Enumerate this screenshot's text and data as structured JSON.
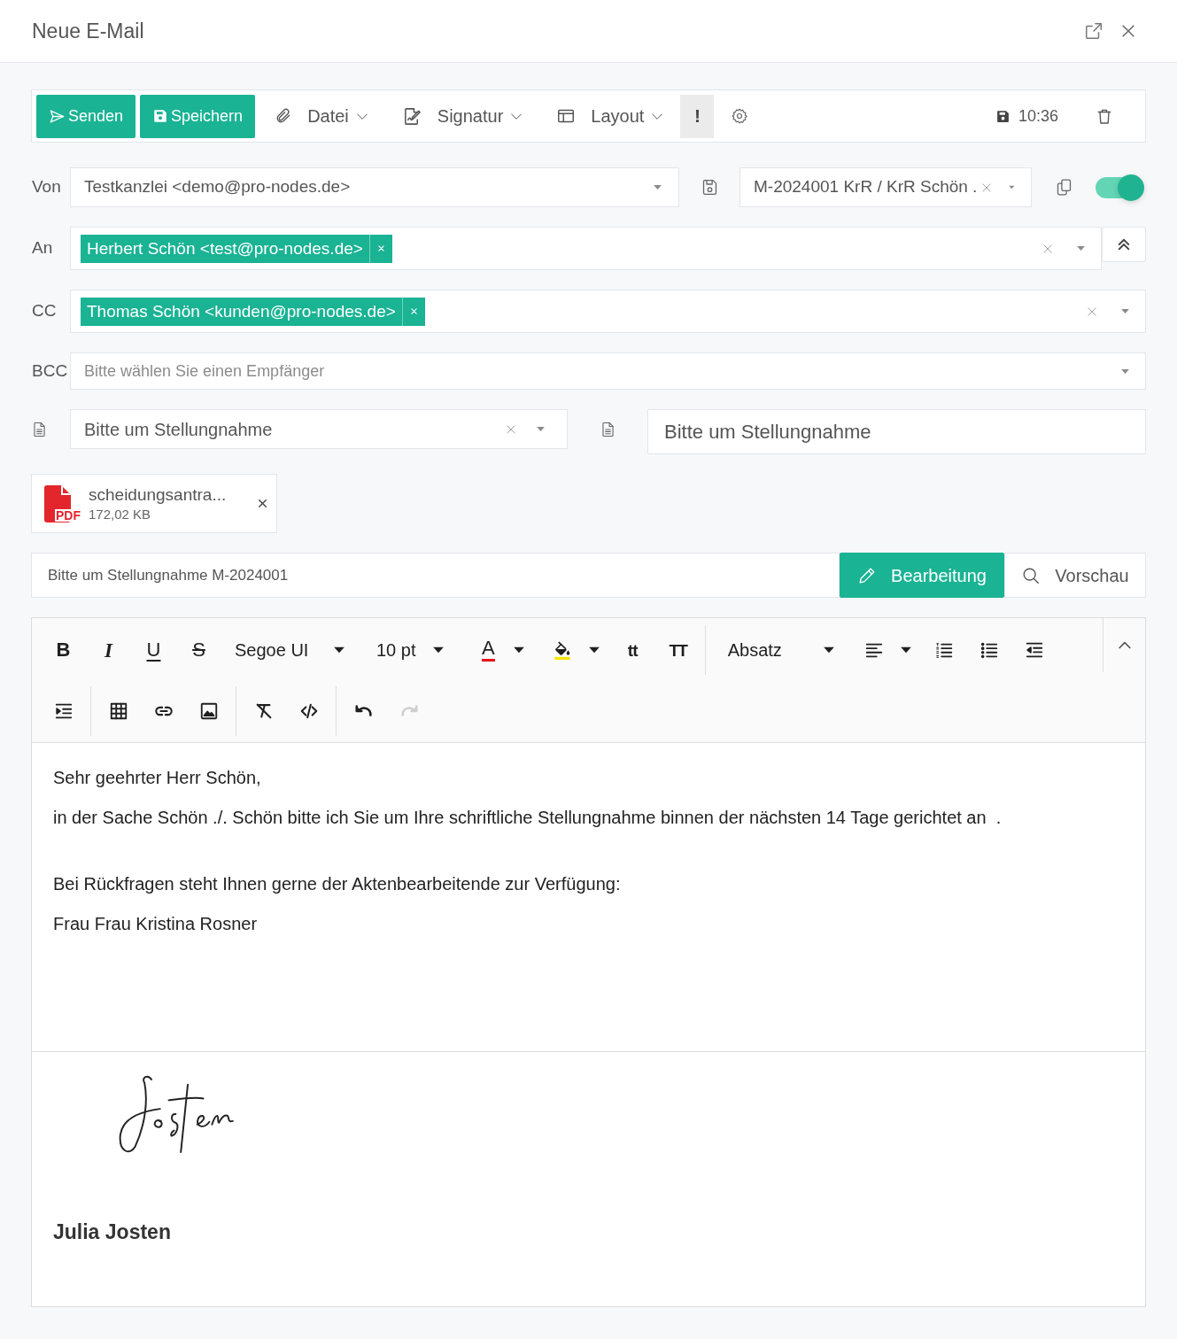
{
  "window": {
    "title": "Neue E-Mail"
  },
  "toolbar": {
    "actions": [
      {
        "kind": "send",
        "label": "Senden"
      },
      {
        "kind": "save",
        "label": "Speichern"
      }
    ],
    "menus": [
      {
        "kind": "attach",
        "label": "Datei"
      },
      {
        "kind": "signature",
        "label": "Signatur"
      },
      {
        "kind": "layout",
        "label": "Layout"
      }
    ],
    "priority": {
      "label": "!",
      "on": true
    },
    "saved_time": "10:36"
  },
  "from": {
    "label": "Von",
    "value": "Testkanzlei <demo@pro-nodes.de>"
  },
  "case_file": {
    "value": "M-2024001 KrR / KrR Schön ."
  },
  "case_link": {
    "on": true
  },
  "to": {
    "label": "An",
    "recipients": [
      "Herbert Schön <test@pro-nodes.de>"
    ]
  },
  "cc": {
    "label": "CC",
    "recipients": [
      "Thomas Schön <kunden@pro-nodes.de>"
    ]
  },
  "bcc": {
    "label": "BCC",
    "placeholder": "Bitte wählen Sie einen Empfänger"
  },
  "template": {
    "value": "Bitte um Stellungnahme"
  },
  "template_title": {
    "value": "Bitte um Stellungnahme"
  },
  "attachments": [
    {
      "type": "PDF",
      "name": "scheidungsantra...",
      "size": "172,02 KB"
    }
  ],
  "subject": {
    "value": "Bitte um Stellungnahme M-2024001"
  },
  "view_tabs": [
    {
      "kind": "edit",
      "label": "Bearbeitung",
      "selected": true
    },
    {
      "kind": "preview",
      "label": "Vorschau",
      "selected": false
    }
  ],
  "editor": {
    "toolbar_rows": [
      [
        [
          {
            "kind": "bold",
            "glyph": "B",
            "disabled": false
          },
          {
            "kind": "italic",
            "glyph": "I",
            "disabled": false
          },
          {
            "kind": "underline",
            "glyph": "U",
            "disabled": false
          },
          {
            "kind": "strike",
            "glyph": "S",
            "disabled": false
          },
          {
            "kind": "font",
            "label": "Segoe UI",
            "disabled": false
          },
          {
            "kind": "size",
            "label": "10 pt",
            "disabled": false
          },
          {
            "kind": "font_color",
            "glyph": "A",
            "disabled": false
          },
          {
            "kind": "highlight",
            "disabled": false
          },
          {
            "kind": "lowercase",
            "glyph": "tt",
            "disabled": false
          },
          {
            "kind": "uppercase",
            "glyph": "TT",
            "disabled": false
          }
        ],
        [
          {
            "kind": "block",
            "label": "Absatz",
            "disabled": false
          },
          {
            "kind": "align",
            "disabled": false
          },
          {
            "kind": "ordered_list",
            "disabled": false
          },
          {
            "kind": "unordered_list",
            "disabled": false
          },
          {
            "kind": "outdent",
            "disabled": false
          }
        ]
      ],
      [
        [
          {
            "kind": "indent",
            "disabled": false
          }
        ],
        [
          {
            "kind": "table",
            "disabled": false
          },
          {
            "kind": "link",
            "disabled": false
          },
          {
            "kind": "image",
            "disabled": false
          }
        ],
        [
          {
            "kind": "clear_format",
            "disabled": false
          },
          {
            "kind": "code_view",
            "disabled": false
          }
        ],
        [
          {
            "kind": "undo",
            "disabled": false
          },
          {
            "kind": "redo",
            "disabled": true
          }
        ]
      ]
    ],
    "body": [
      [
        "Sehr geehrter Herr Schön,",
        "in der Sache Schön ./. Schön bitte ich Sie um Ihre schriftliche Stellungnahme binnen der nächsten 14 Tage gerichtet an  ."
      ],
      [
        "Bei Rückfragen steht Ihnen gerne der Aktenbearbeitende zur Verfügung:",
        "Frau Frau Kristina Rosner"
      ]
    ],
    "signature": {
      "name": "Julia Josten"
    }
  }
}
